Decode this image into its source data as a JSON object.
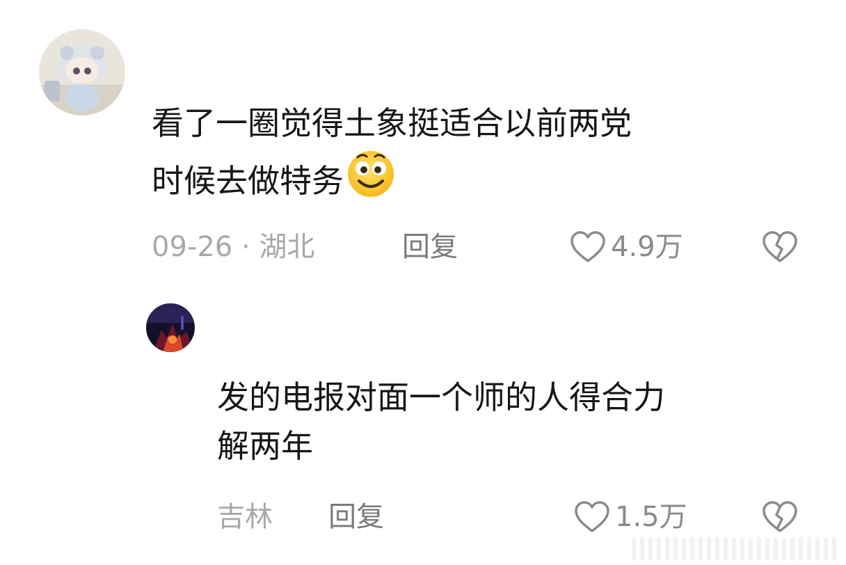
{
  "comments": [
    {
      "text_line1": "看了一圈觉得土象挺适合以前两党",
      "text_line2": "时候去做特务",
      "emoji": "smiling-face-emoji",
      "meta": "09-26 · 湖北",
      "reply": "回复",
      "likes": "4.9万",
      "like_icon": "heart-icon",
      "dislike_icon": "broken-heart-icon"
    },
    {
      "text_line1": "发的电报对面一个师的人得合力",
      "text_line2": "解两年",
      "meta": "吉林",
      "reply": "回复",
      "likes": "1.5万",
      "like_icon": "heart-icon",
      "dislike_icon": "broken-heart-icon"
    }
  ],
  "colors": {
    "text": "#161616",
    "meta": "#a8a8a8",
    "reply": "#7a7a7a",
    "icon": "#8a8a8a"
  }
}
